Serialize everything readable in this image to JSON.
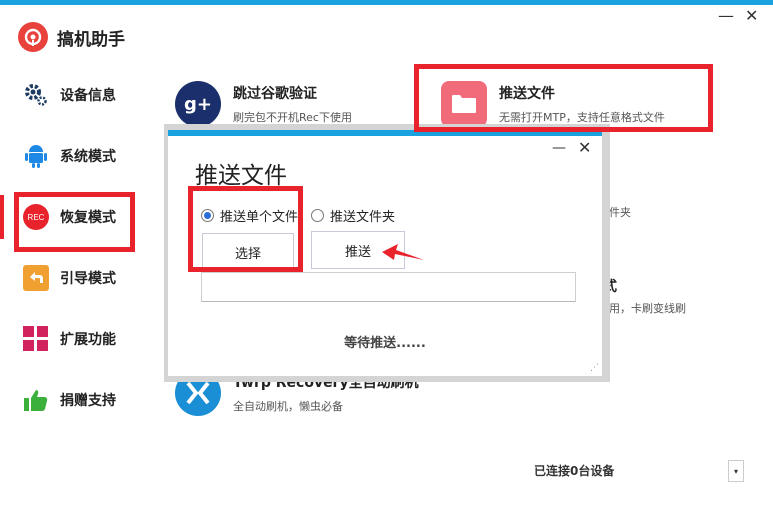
{
  "app": {
    "title": "搞机助手",
    "minimize": "—",
    "close": "✕"
  },
  "sidebar": {
    "items": [
      {
        "label": "设备信息",
        "icon": "gear-icon"
      },
      {
        "label": "系统模式",
        "icon": "android-icon"
      },
      {
        "label": "恢复模式",
        "icon": "rec-icon",
        "icon_text": "REC",
        "active": true
      },
      {
        "label": "引导模式",
        "icon": "back-arrow-icon"
      },
      {
        "label": "扩展功能",
        "icon": "grid-icon"
      },
      {
        "label": "捐赠支持",
        "icon": "thumbs-up-icon"
      }
    ]
  },
  "cards": [
    {
      "title": "跳过谷歌验证",
      "desc": "刷完包不开机Rec下使用",
      "icon": "google-plus-icon",
      "icon_text": "g+"
    },
    {
      "title": "推送文件",
      "desc": "无需打开MTP，支持任意格式文件",
      "icon": "folder-icon"
    },
    {
      "title": "Twrp Recovery全自动刷机",
      "desc": "全自动刷机，懒虫必备",
      "icon": "twrp-icon"
    }
  ],
  "partial_texts": [
    "文件夹",
    "式",
    "使用，卡刷变线刷"
  ],
  "dialog": {
    "title": "推送文件",
    "minimize": "—",
    "close": "✕",
    "options": [
      {
        "label": "推送单个文件",
        "selected": true
      },
      {
        "label": "推送文件夹",
        "selected": false
      }
    ],
    "select_label": "选择",
    "push_label": "推送",
    "file_path": "",
    "status": "等待推送......"
  },
  "footer": {
    "status": "已连接0台设备",
    "dropdown_arrow": "▾"
  },
  "colors": {
    "accent": "#1aa1e0",
    "highlight": "#e8232b",
    "logo_red": "#e9413c"
  }
}
